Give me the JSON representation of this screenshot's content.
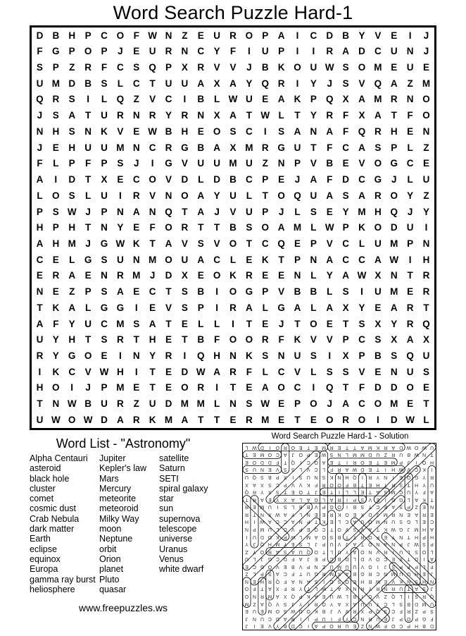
{
  "title": "Word Search Puzzle Hard-1",
  "footer": {
    "url": "www.freepuzzles.ws"
  },
  "wordlist": {
    "title": "Word List - \"Astronomy\"",
    "columns": [
      [
        "Alpha Centauri",
        "asteroid",
        "black hole",
        "cluster",
        "comet",
        "cosmic dust",
        "Crab Nebula",
        "dark matter",
        "Earth",
        "eclipse",
        "equinox",
        "Europa",
        "gamma ray burst",
        "heliosphere"
      ],
      [
        "Jupiter",
        "Kepler's law",
        "Mars",
        "Mercury",
        "meteorite",
        "meteoroid",
        "Milky Way",
        "moon",
        "Neptune",
        "orbit",
        "Orion",
        "planet",
        "Pluto",
        "quasar"
      ],
      [
        "satellite",
        "Saturn",
        "SETI",
        "spiral galaxy",
        "star",
        "sun",
        "supernova",
        "telescope",
        "universe",
        "Uranus",
        "Venus",
        "white dwarf"
      ]
    ]
  },
  "solution": {
    "title": "Word Search Puzzle Hard-1 - Solution",
    "rotation_degrees": 180
  },
  "grid": {
    "rows": 25,
    "cols": 25,
    "letters": [
      "DBHPCOFWNZEUROPAICDBYVEIJ",
      "FGPOPJEURNCYFIUPIIRADCUNJ",
      "SPZRFCSQPXRVVJBKOUWSOMEUE",
      "UMDBSLCTUUAXAYQRIYJSVQAZM",
      "QRSILQZVCIBLWUEAKPQXAMRNO",
      "JSATURNRYRNXATWLTYRFXATFO",
      "NHSNKVEWBHEOSCISANAFQRHEN",
      "JEHUUMNCRGBAXMRGUTFCASPLZ",
      "FLPFPSJIGVUUMUZNPVBEVOGCE",
      "AIDTXECOVDLDBCPEJAFDCGJLU",
      "LOSLUIRVNOAYULTOQUASAROYZ",
      "PSWJPNANQTAJVUPJLSEYMHQJY",
      "HPHTNYEFORTTBSOAMLWPKODUI",
      "AHMJGWKTAVSVOTCQEPVCLUMPN",
      "CELGSUNMOUACLEKTPNACCAWIH",
      "ERAENRMJDXEOKREENLYAWXNTR",
      "NEZPSAECTSBIOGPVBBLSIUMER",
      "TKALGGIEVSPIRALGALAXYEART",
      "AFYUCMSATELLITEJTOETSXYRQ",
      "UYHTSRTHETBFOORFKVVPCSXAX",
      "RYGOEINYRIQHNKSNUSIXPBSQU",
      "IKCVWHITEDWARFLCVLSSVENUS",
      "HOIJPMETEORITEAOCIQTFDDOE",
      "TNWBURZUDMMLNSWEPOJACOMET",
      "UWOWDARKMATTERMETEOROIDWL"
    ]
  }
}
